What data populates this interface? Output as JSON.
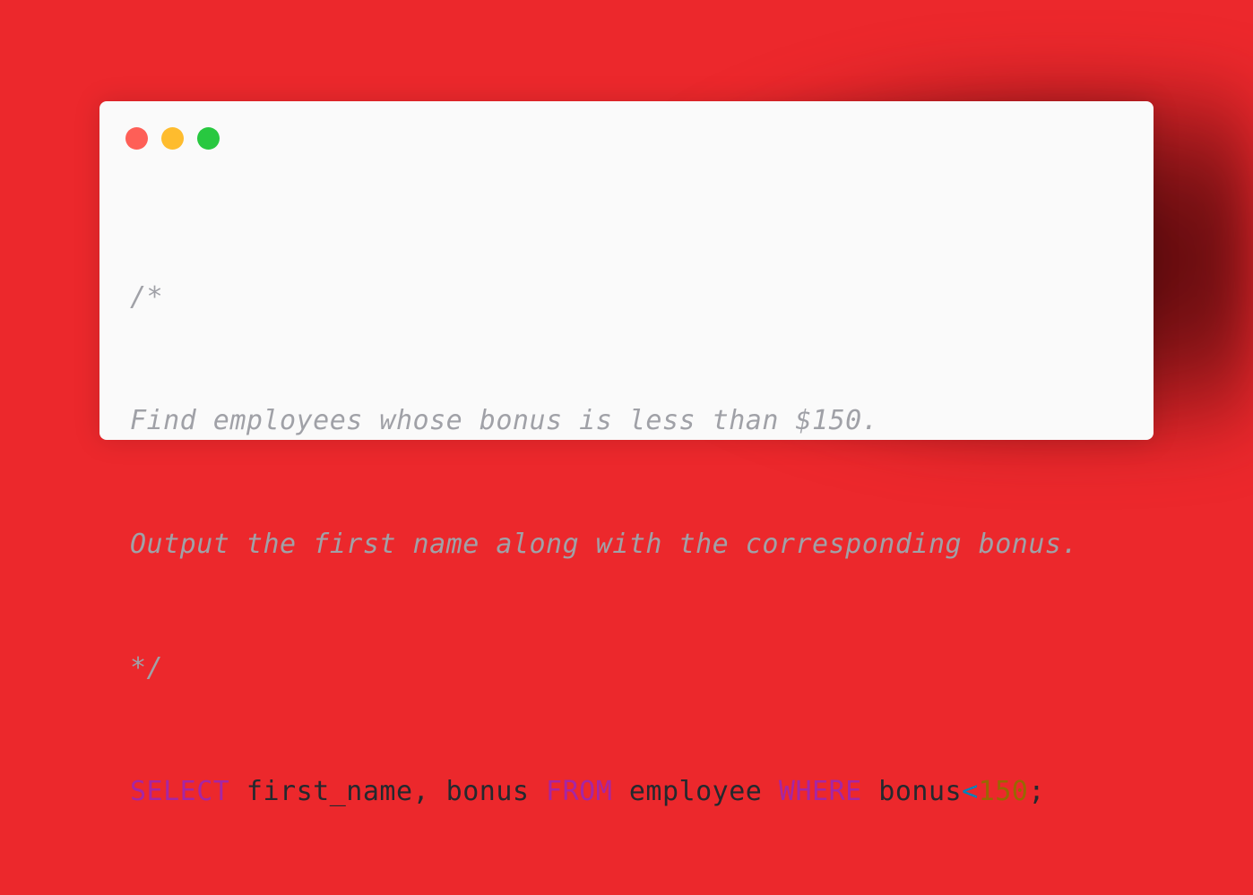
{
  "window": {
    "controls": [
      "close",
      "minimize",
      "maximize"
    ],
    "colors": {
      "close": "#fe5f57",
      "minimize": "#febc2e",
      "maximize": "#28c840",
      "background": "#ec282c"
    }
  },
  "code": {
    "comment_open": "/*",
    "comment_line1": "Find employees whose bonus is less than $150.",
    "comment_line2": "Output the first name along with the corresponding bonus.",
    "comment_close": "*/",
    "sql": {
      "kw_select": "SELECT",
      "cols": " first_name, bonus ",
      "kw_from": "FROM",
      "table": " employee ",
      "kw_where": "WHERE",
      "cond_col": " bonus",
      "operator": "<",
      "value": "150",
      "terminator": ";"
    }
  }
}
